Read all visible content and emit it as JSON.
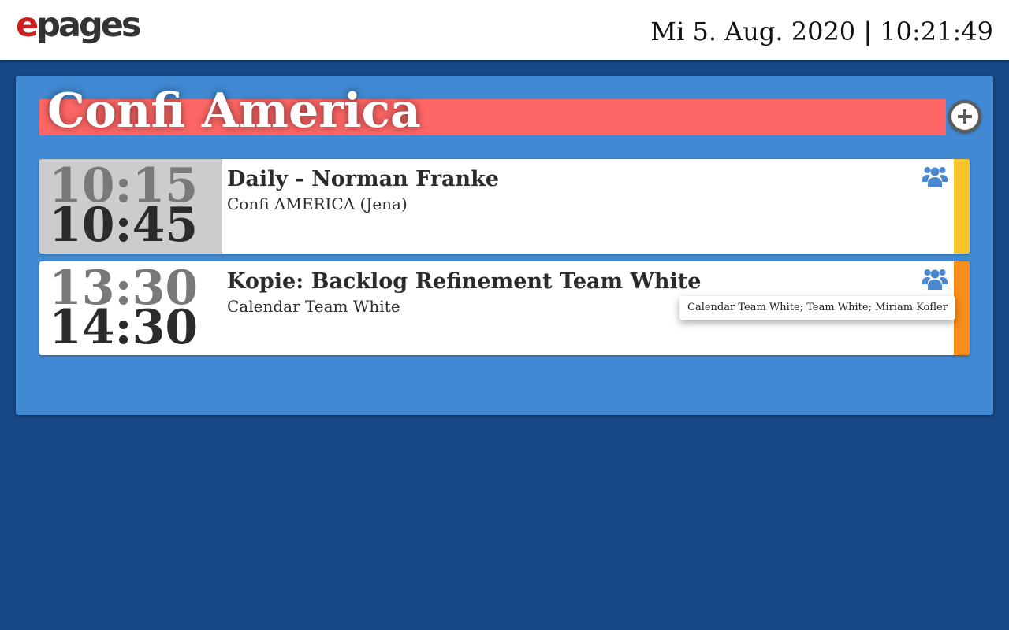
{
  "header": {
    "logo_e": "e",
    "logo_rest": "pages",
    "datetime": "Mi 5. Aug. 2020 | 10:21:49"
  },
  "room": {
    "title": "Confi America",
    "add_icon": "plus-circle-icon"
  },
  "events": [
    {
      "start": "10:15",
      "end": "10:45",
      "title": "Daily - Norman Franke",
      "location": "Confi AMERICA (Jena)",
      "attendees_icon": "users-icon",
      "status_color": "#f7c52a"
    },
    {
      "start": "13:30",
      "end": "14:30",
      "title": "Kopie: Backlog Refinement Team White",
      "location": "Calendar Team White",
      "attendees_icon": "users-icon",
      "status_color": "#f98d1a"
    }
  ],
  "tooltip": {
    "text": "Calendar Team White; Team White; Miriam Kofler"
  },
  "colors": {
    "background": "#174785",
    "panel": "#4189d2",
    "room_header": "#ff6666",
    "icon_blue": "#4a89d0"
  }
}
